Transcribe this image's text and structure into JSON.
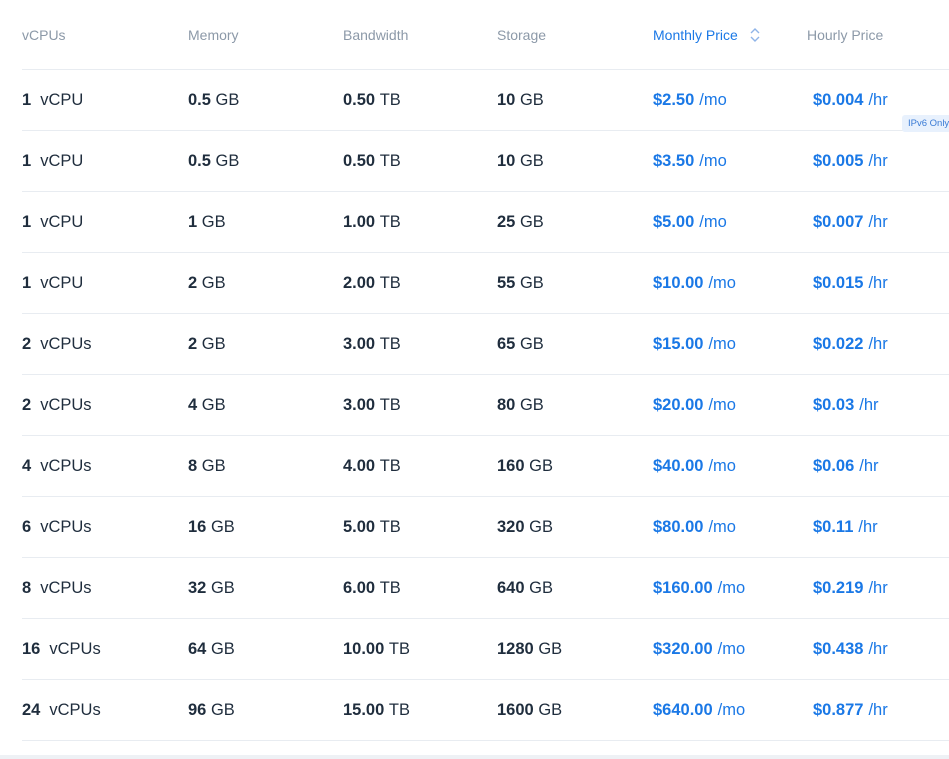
{
  "columns": {
    "vcpus": "vCPUs",
    "memory": "Memory",
    "bandwidth": "Bandwidth",
    "storage": "Storage",
    "monthly": "Monthly Price",
    "hourly": "Hourly Price"
  },
  "badge": "IPv6 Only",
  "colors": {
    "accent": "#1a78e6",
    "text": "#1f2d3d",
    "header_text": "#8c99a8",
    "divider": "#e8ecf1"
  },
  "rows": [
    {
      "cpu": "1",
      "cpu_unit": "vCPU",
      "mem": "0.5",
      "mem_unit": "GB",
      "bw": "0.50",
      "bw_unit": "TB",
      "sto": "10",
      "sto_unit": "GB",
      "month": "$2.50",
      "month_unit": "/mo",
      "hour": "$0.004",
      "hour_unit": "/hr"
    },
    {
      "cpu": "1",
      "cpu_unit": "vCPU",
      "mem": "0.5",
      "mem_unit": "GB",
      "bw": "0.50",
      "bw_unit": "TB",
      "sto": "10",
      "sto_unit": "GB",
      "month": "$3.50",
      "month_unit": "/mo",
      "hour": "$0.005",
      "hour_unit": "/hr"
    },
    {
      "cpu": "1",
      "cpu_unit": "vCPU",
      "mem": "1",
      "mem_unit": "GB",
      "bw": "1.00",
      "bw_unit": "TB",
      "sto": "25",
      "sto_unit": "GB",
      "month": "$5.00",
      "month_unit": "/mo",
      "hour": "$0.007",
      "hour_unit": "/hr"
    },
    {
      "cpu": "1",
      "cpu_unit": "vCPU",
      "mem": "2",
      "mem_unit": "GB",
      "bw": "2.00",
      "bw_unit": "TB",
      "sto": "55",
      "sto_unit": "GB",
      "month": "$10.00",
      "month_unit": "/mo",
      "hour": "$0.015",
      "hour_unit": "/hr"
    },
    {
      "cpu": "2",
      "cpu_unit": "vCPUs",
      "mem": "2",
      "mem_unit": "GB",
      "bw": "3.00",
      "bw_unit": "TB",
      "sto": "65",
      "sto_unit": "GB",
      "month": "$15.00",
      "month_unit": "/mo",
      "hour": "$0.022",
      "hour_unit": "/hr"
    },
    {
      "cpu": "2",
      "cpu_unit": "vCPUs",
      "mem": "4",
      "mem_unit": "GB",
      "bw": "3.00",
      "bw_unit": "TB",
      "sto": "80",
      "sto_unit": "GB",
      "month": "$20.00",
      "month_unit": "/mo",
      "hour": "$0.03",
      "hour_unit": "/hr"
    },
    {
      "cpu": "4",
      "cpu_unit": "vCPUs",
      "mem": "8",
      "mem_unit": "GB",
      "bw": "4.00",
      "bw_unit": "TB",
      "sto": "160",
      "sto_unit": "GB",
      "month": "$40.00",
      "month_unit": "/mo",
      "hour": "$0.06",
      "hour_unit": "/hr"
    },
    {
      "cpu": "6",
      "cpu_unit": "vCPUs",
      "mem": "16",
      "mem_unit": "GB",
      "bw": "5.00",
      "bw_unit": "TB",
      "sto": "320",
      "sto_unit": "GB",
      "month": "$80.00",
      "month_unit": "/mo",
      "hour": "$0.11",
      "hour_unit": "/hr"
    },
    {
      "cpu": "8",
      "cpu_unit": "vCPUs",
      "mem": "32",
      "mem_unit": "GB",
      "bw": "6.00",
      "bw_unit": "TB",
      "sto": "640",
      "sto_unit": "GB",
      "month": "$160.00",
      "month_unit": "/mo",
      "hour": "$0.219",
      "hour_unit": "/hr"
    },
    {
      "cpu": "16",
      "cpu_unit": "vCPUs",
      "mem": "64",
      "mem_unit": "GB",
      "bw": "10.00",
      "bw_unit": "TB",
      "sto": "1280",
      "sto_unit": "GB",
      "month": "$320.00",
      "month_unit": "/mo",
      "hour": "$0.438",
      "hour_unit": "/hr"
    },
    {
      "cpu": "24",
      "cpu_unit": "vCPUs",
      "mem": "96",
      "mem_unit": "GB",
      "bw": "15.00",
      "bw_unit": "TB",
      "sto": "1600",
      "sto_unit": "GB",
      "month": "$640.00",
      "month_unit": "/mo",
      "hour": "$0.877",
      "hour_unit": "/hr"
    }
  ]
}
